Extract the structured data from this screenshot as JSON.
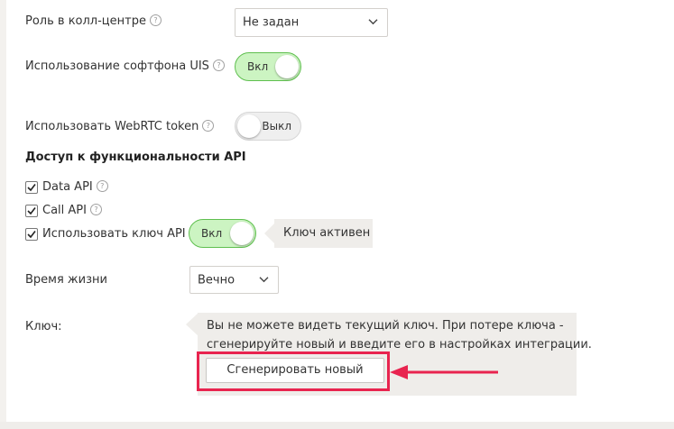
{
  "fields": {
    "role": {
      "label": "Роль в колл-центре",
      "value": "Не задан"
    },
    "softphone": {
      "label": "Использование софтфона UIS",
      "toggle_label": "Вкл",
      "enabled": true
    },
    "webrtc": {
      "label": "Использовать WebRTC token",
      "toggle_label": "Выкл",
      "enabled": false
    }
  },
  "api_section": {
    "heading": "Доступ к функциональности API",
    "data_api": {
      "label": "Data API",
      "checked": true
    },
    "call_api": {
      "label": "Call API",
      "checked": true
    },
    "use_key": {
      "label": "Использовать ключ API",
      "checked": true,
      "toggle_label": "Вкл",
      "enabled": true,
      "status": "Ключ активен"
    }
  },
  "lifetime": {
    "label": "Время жизни",
    "value": "Вечно"
  },
  "key": {
    "label": "Ключ:",
    "hint_line1": "Вы не можете видеть текущий ключ. При потере ключа -",
    "hint_line2": "сгенерируйте новый и введите его в настройках интеграции.",
    "generate_button": "Сгенерировать новый"
  },
  "help_glyph": "?",
  "colors": {
    "toggle_on_bg": "#ccf4c2",
    "toggle_on_border": "#5fbf4f",
    "highlight": "#e8244f",
    "hint_bg": "#efedea"
  },
  "icons": {
    "select_arrow": "chevron-down-icon",
    "check": "check-icon",
    "help": "question-circle-icon",
    "annotation": "red-arrow-icon"
  }
}
